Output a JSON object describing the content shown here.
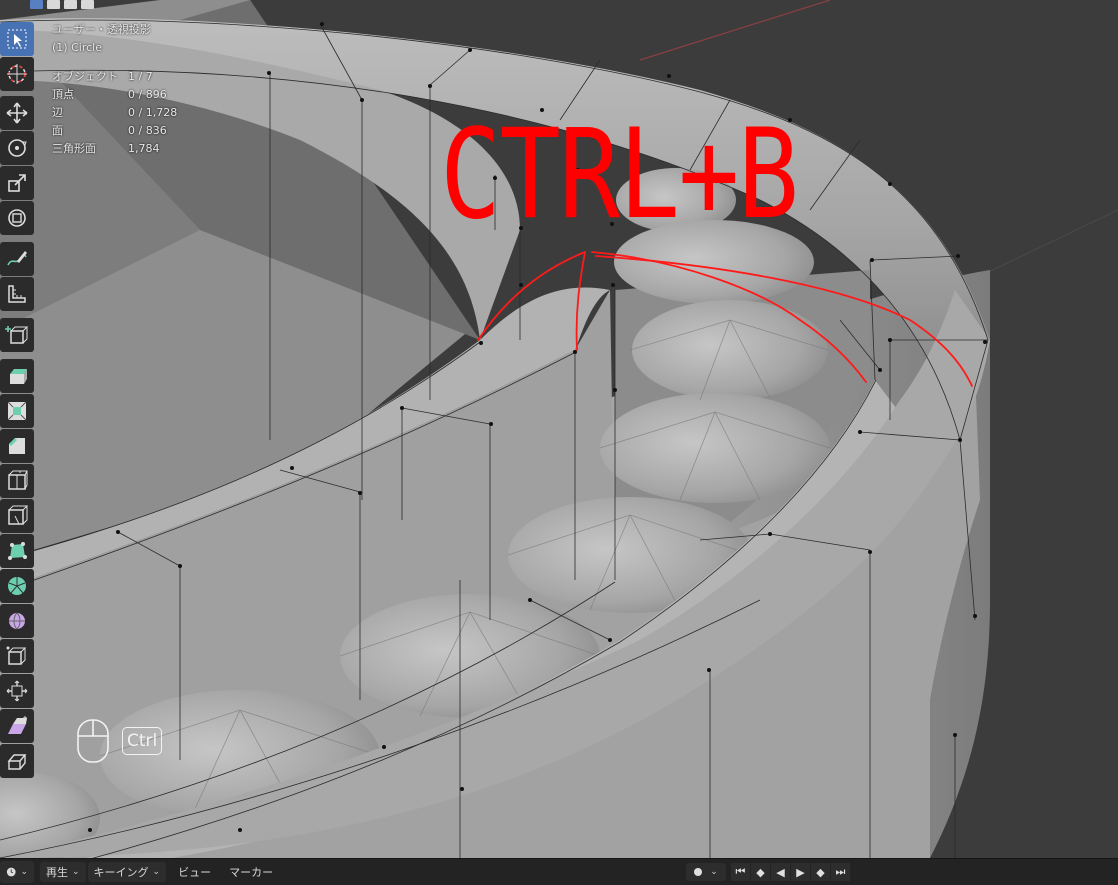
{
  "viewport": {
    "view_name": "ユーザー・透視投影",
    "active_object": "(1) Circle",
    "stats": [
      {
        "label": "オブジェクト",
        "value": "1 / 7"
      },
      {
        "label": "頂点",
        "value": "0 / 896"
      },
      {
        "label": "辺",
        "value": "0 / 1,728"
      },
      {
        "label": "面",
        "value": "0 / 836"
      },
      {
        "label": "三角形面",
        "value": "1,784"
      }
    ]
  },
  "annotation": {
    "shortcut_text": "CTRL+B",
    "color": "#ff0000"
  },
  "input_hint": {
    "key_label": "Ctrl",
    "mouse_icon": "mouse-icon"
  },
  "toolbar": {
    "tools": [
      "select-box-icon",
      "cursor-icon",
      "move-icon",
      "rotate-icon",
      "scale-icon",
      "transform-icon",
      "annotate-icon",
      "measure-icon",
      "add-cube-icon",
      "extrude-icon",
      "inset-icon",
      "bevel-icon",
      "loop-cut-icon",
      "knife-icon",
      "poly-build-icon",
      "spin-icon",
      "smooth-icon",
      "edge-slide-icon",
      "shrink-fatten-icon",
      "shear-icon",
      "rip-icon"
    ],
    "active_tool": "select-box-icon"
  },
  "timeline": {
    "playback_label": "再生",
    "keying_label": "キーイング",
    "view_label": "ビュー",
    "marker_label": "マーカー",
    "transport": [
      "jump-start-icon",
      "prev-keyframe-icon",
      "play-reverse-icon",
      "play-icon",
      "next-keyframe-icon",
      "jump-end-icon"
    ]
  },
  "colors": {
    "accent": "#4772b3",
    "viewport_bg": "#3a3a3a",
    "mesh": "#a6a6a6",
    "annotation": "#ff0000"
  }
}
